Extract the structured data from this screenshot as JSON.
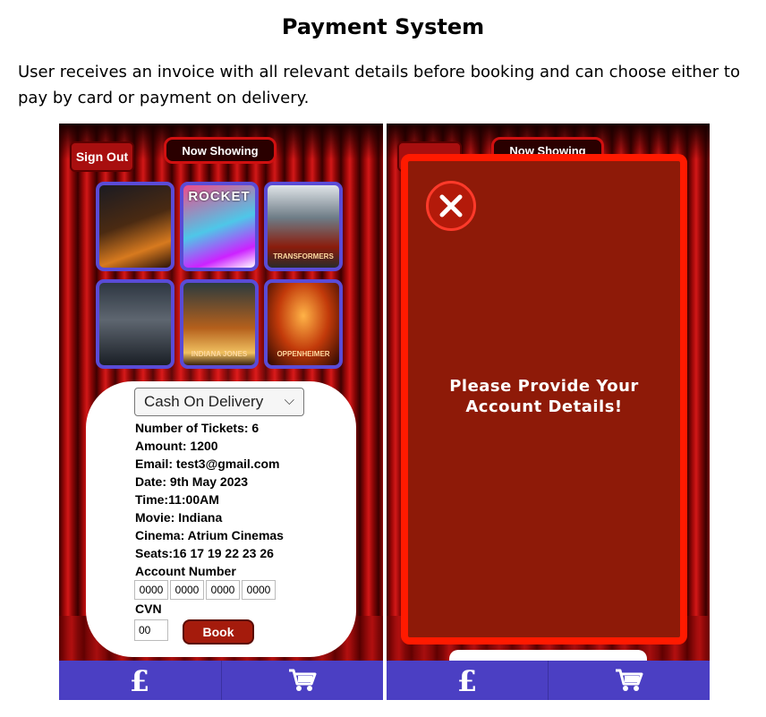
{
  "document": {
    "title": "Payment System",
    "description": "User receives an invoice with all relevant details before booking and can choose either to pay by card or payment on delivery."
  },
  "left_screen": {
    "sign_out_label": "Sign Out",
    "now_showing_label": "Now Showing",
    "posters": [
      {
        "label": ""
      },
      {
        "label": "ROCKET"
      },
      {
        "label": "TRANSFORMERS"
      },
      {
        "label": ""
      },
      {
        "label": "INDIANA JONES"
      },
      {
        "label": "OPPENHEIMER"
      }
    ],
    "invoice": {
      "payment_method": "Cash On Delivery",
      "lines": [
        "Number of Tickets: 6",
        "Amount: 1200",
        "Email: test3@gmail.com",
        "Date: 9th May 2023",
        "Time:11:00AM",
        "Movie: Indiana",
        "Cinema: Atrium Cinemas",
        "Seats:16 17 19 22 23 26"
      ],
      "account_number_label": "Account Number",
      "account_boxes": [
        "0000",
        "0000",
        "0000",
        "0000"
      ],
      "cvn_label": "CVN",
      "cvn_value": "00",
      "book_label": "Book"
    }
  },
  "right_screen": {
    "now_showing_label": "Now Showing",
    "modal_message_line1": "Please Provide Your",
    "modal_message_line2": "Account Details!"
  },
  "bottom_bar": {
    "icons": [
      "pound-icon",
      "cart-icon"
    ]
  },
  "colors": {
    "accent_red": "#a51b0c",
    "nav_blue": "#4b3fc3",
    "modal_red": "#8e1a08",
    "poster_border": "#5a4bd6"
  }
}
